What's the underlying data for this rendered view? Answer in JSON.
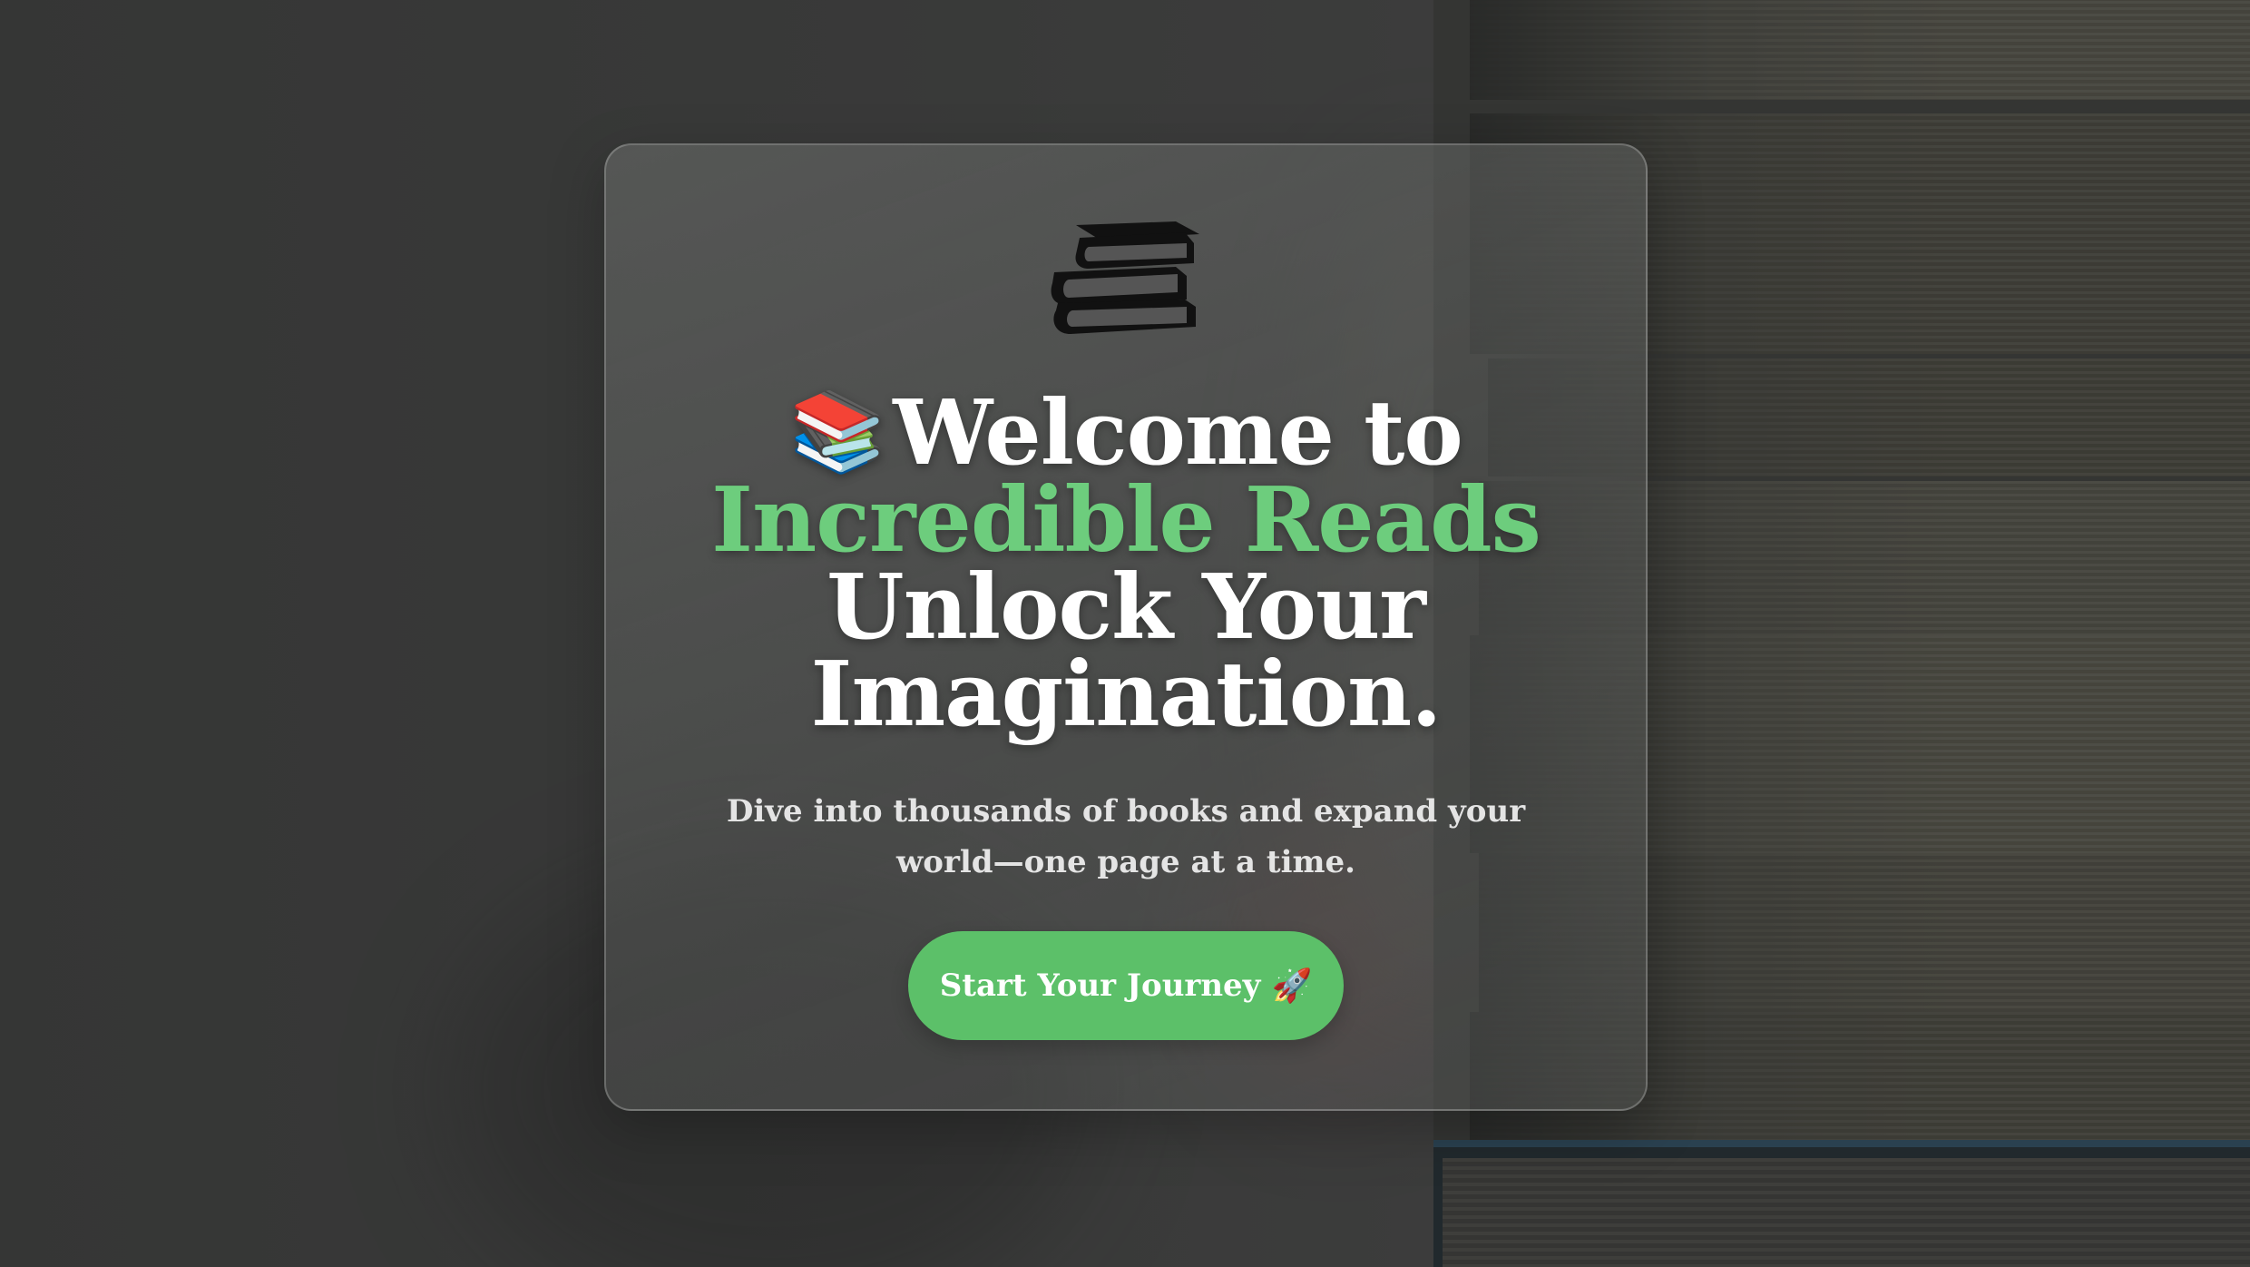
{
  "hero": {
    "title_emoji": "📚",
    "title_line1": "Welcome to",
    "title_line2": "Incredible Reads",
    "title_line3": "Unlock Your",
    "title_line4": "Imagination.",
    "subtitle": "Dive into thousands of books and expand your world—one page at a time.",
    "cta_label": "Start Your Journey",
    "cta_emoji": "🚀"
  },
  "icons": {
    "logo": "book-stack-icon",
    "cta": "rocket-icon"
  },
  "colors": {
    "accent": "#6dcd7d",
    "cta_background": "#5cc069",
    "text": "#ffffff",
    "subtitle": "#e4e4e4"
  }
}
